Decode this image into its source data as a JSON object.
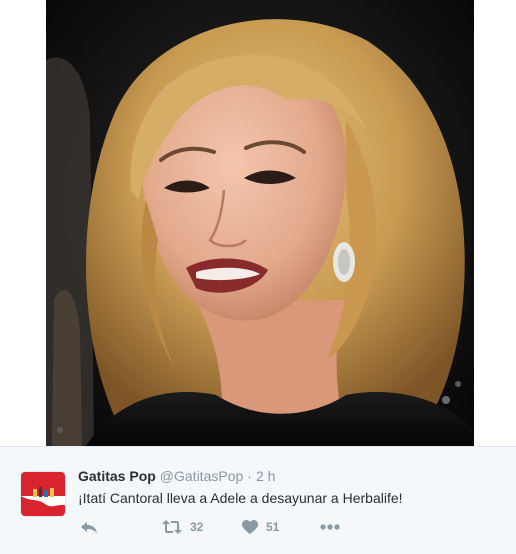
{
  "tweet": {
    "display_name": "Gatitas Pop",
    "handle": "@GatitasPop",
    "separator": "·",
    "time": "2 h",
    "text": "¡Itatí Cantoral lleva a Adele a desayunar a Herbalife!",
    "retweet_count": "32",
    "like_count": "51"
  },
  "icons": {
    "reply": "reply-icon",
    "retweet": "retweet-icon",
    "like": "heart-icon",
    "more": "more-dots-icon",
    "avatar": "avatar"
  },
  "colors": {
    "action_gray": "#8899a6",
    "name": "#292f33",
    "tweet_background": "#f5f8fa",
    "avatar_red": "#d9232e"
  }
}
